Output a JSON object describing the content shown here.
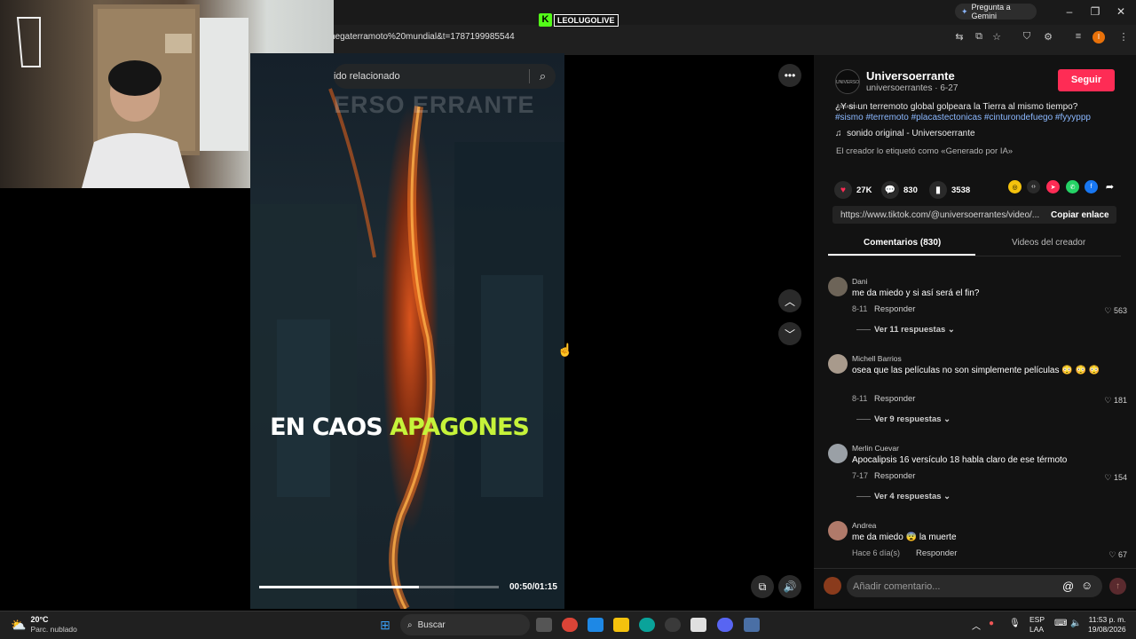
{
  "browser": {
    "url": "negaterramoto%20mundial&t=1787199985544",
    "gemini_label": "Pregunta a Gemini",
    "profile_initial": "I"
  },
  "stream_overlay": {
    "kick_letter": "K",
    "channel": "LEOLUGOLIVE"
  },
  "video": {
    "search_placeholder": "ido relacionado",
    "watermark": "ERSO ERRANTE",
    "caption_white": "EN CAOS",
    "caption_green": "APAGONES",
    "caption_green_color": "#c6f33a",
    "time": "00:50/01:15",
    "progress_fraction": 0.667
  },
  "post": {
    "avatar_text": "UNIVERSO ERRANTE",
    "author": "Universoerrante",
    "handle": "universoerrantes · 6-27",
    "follow_label": "Seguir",
    "desc_text": "¿Y si un terremoto global golpeara la Tierra al mismo tiempo? ",
    "desc_tags": "#sismo #terremoto #placastectonicas #cinturondefuego #fyyyppp",
    "music": "sonido original - Universoerrante",
    "ai_label": "El creador lo etiquetó como «Generado por IA»",
    "likes": "27K",
    "comments": "830",
    "saves": "3538",
    "link": "https://www.tiktok.com/@universoerrantes/video/...",
    "copy_label": "Copiar enlace",
    "tab_comments": "Comentarios (830)",
    "tab_videos": "Videos del creador",
    "accent_color": "#fe2c55"
  },
  "comments": [
    {
      "name": "Dani",
      "text": "me da miedo y si así será el fin?",
      "date": "8-11",
      "reply": "Responder",
      "likes": "563",
      "more": "Ver 11 respuestas"
    },
    {
      "name": "Michell Barrios",
      "text": "osea que las películas no son simplemente películas 😳 😳 😳",
      "date": "8-11",
      "reply": "Responder",
      "likes": "181",
      "more": "Ver 9 respuestas"
    },
    {
      "name": "Merlin Cuevar",
      "text": "Apocalipsis 16 versículo 18 habla claro de ese térmoto",
      "date": "7-17",
      "reply": "Responder",
      "likes": "154",
      "more": "Ver 4 respuestas"
    },
    {
      "name": "Andrea",
      "text": "me da miedo 😨 la muerte",
      "date": "Hace 6 día(s)",
      "reply": "Responder",
      "likes": "67",
      "more": ""
    }
  ],
  "comment_input": {
    "placeholder": "Añadir comentario..."
  },
  "taskbar": {
    "temp": "20°C",
    "weather": "Parc. nublado",
    "search": "Buscar",
    "lang1": "ESP",
    "lang2": "LAA",
    "time": "11:53 p. m.",
    "date": "19/08/2026"
  }
}
